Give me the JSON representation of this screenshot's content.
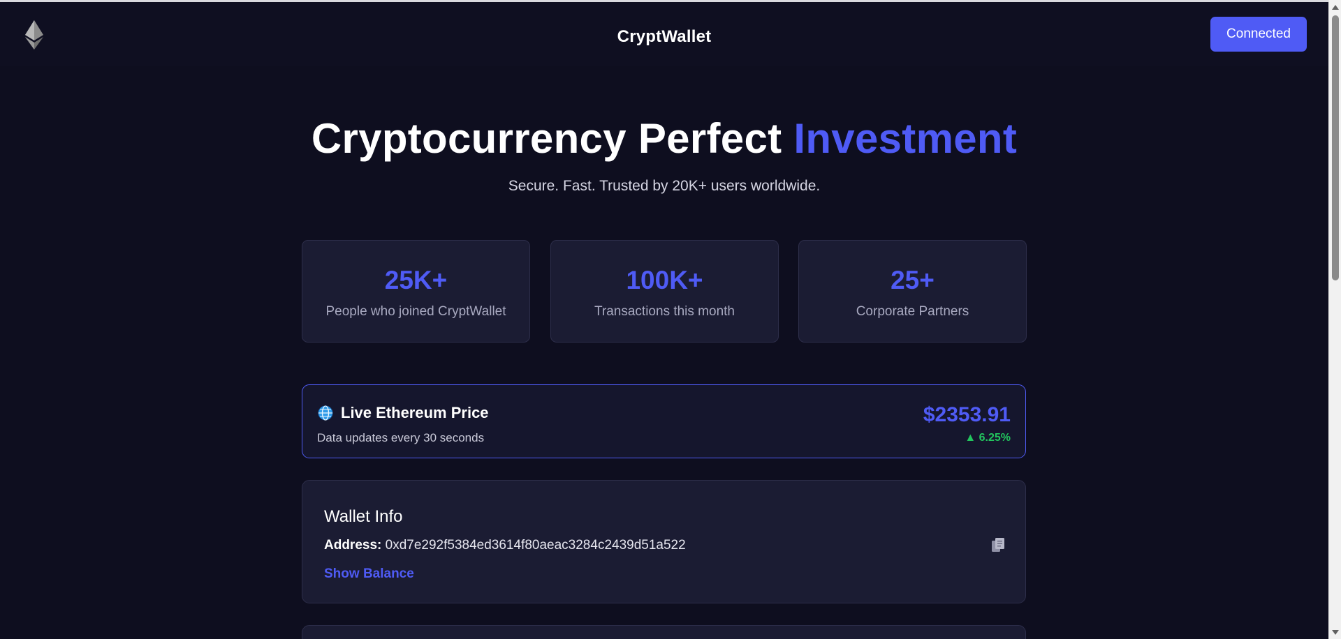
{
  "header": {
    "app_title": "CryptWallet",
    "connect_button": "Connected",
    "logo_icon": "ethereum-logo-icon"
  },
  "hero": {
    "title_main": "Cryptocurrency Perfect ",
    "title_accent": "Investment",
    "subtitle": "Secure. Fast. Trusted by 20K+ users worldwide."
  },
  "stats": [
    {
      "value": "25K+",
      "label": "People who joined CryptWallet"
    },
    {
      "value": "100K+",
      "label": "Transactions this month"
    },
    {
      "value": "25+",
      "label": "Corporate Partners"
    }
  ],
  "price": {
    "icon": "globe-icon",
    "title": "Live Ethereum Price",
    "description": "Data updates every 30 seconds",
    "value": "$2353.91",
    "change": "▲ 6.25%"
  },
  "wallet": {
    "title": "Wallet Info",
    "address_label": "Address:",
    "address": "0xd7e292f5384ed3614f80aeac3284c2439d51a522",
    "copy_icon": "copy-icon",
    "show_balance": "Show Balance"
  },
  "colors": {
    "background": "#0e0e1f",
    "accent": "#4f5bf5",
    "card": "#1b1c33",
    "positive": "#22c55e"
  }
}
